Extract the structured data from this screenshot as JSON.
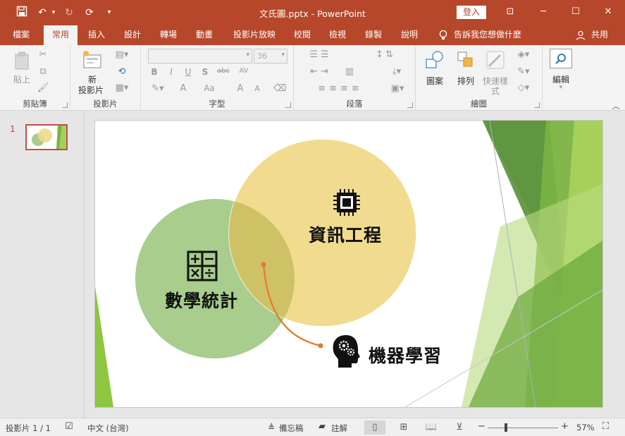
{
  "window": {
    "title": "文氏圖.pptx - PowerPoint",
    "login_label": "登入",
    "minimize_glyph": "─",
    "maximize_glyph": "☐",
    "close_glyph": "✕",
    "ribbon_display_glyph": "⊡"
  },
  "quick_access": {
    "save_glyph": "💾",
    "undo_glyph": "↶",
    "redo_glyph": "↻",
    "present_glyph": "⟳",
    "more_glyph": "▾"
  },
  "tabs": [
    {
      "label": "檔案",
      "active": false
    },
    {
      "label": "常用",
      "active": true
    },
    {
      "label": "插入",
      "active": false
    },
    {
      "label": "設計",
      "active": false
    },
    {
      "label": "轉場",
      "active": false
    },
    {
      "label": "動畫",
      "active": false
    },
    {
      "label": "投影片放映",
      "active": false
    },
    {
      "label": "校閱",
      "active": false
    },
    {
      "label": "檢視",
      "active": false
    },
    {
      "label": "錄製",
      "active": false
    },
    {
      "label": "說明",
      "active": false
    }
  ],
  "tell_me": "告訴我您想做什麼",
  "share_label": "共用",
  "ribbon": {
    "clipboard": {
      "label": "剪貼簿",
      "paste": "貼上"
    },
    "slides": {
      "label": "投影片",
      "new_slide_1": "新",
      "new_slide_2": "投影片"
    },
    "font": {
      "label": "字型",
      "size_value": "36",
      "bold": "B",
      "italic": "I",
      "underline": "U",
      "shadow": "S",
      "strike": "abc",
      "spacing": "AV",
      "case": "Aa",
      "grow": "A",
      "shrink": "A",
      "color": "A"
    },
    "paragraph": {
      "label": "段落"
    },
    "drawing": {
      "label": "繪圖",
      "shapes": "圖案",
      "arrange": "排列",
      "quick_styles_1": "快速樣",
      "quick_styles_2": "式"
    },
    "editing": {
      "label": "編輯"
    }
  },
  "slide_panel": {
    "slide_number": "1"
  },
  "slide": {
    "label_data_science": "資訊工程",
    "label_stats": "數學統計",
    "label_ml": "機器學習",
    "colors": {
      "circle_green": "#a8cd8c",
      "circle_yellow": "#f0da8a",
      "overlap": "#cfc266",
      "arrow": "#e07b2a",
      "deco_dark": "#5f9a3c",
      "deco_light": "#9ccb3f"
    }
  },
  "status": {
    "slide_info": "投影片 1 / 1",
    "language": "中文 (台灣)",
    "notes": "備忘稿",
    "comments": "註解",
    "zoom": "57%",
    "zoom_minus": "−",
    "zoom_plus": "+"
  }
}
